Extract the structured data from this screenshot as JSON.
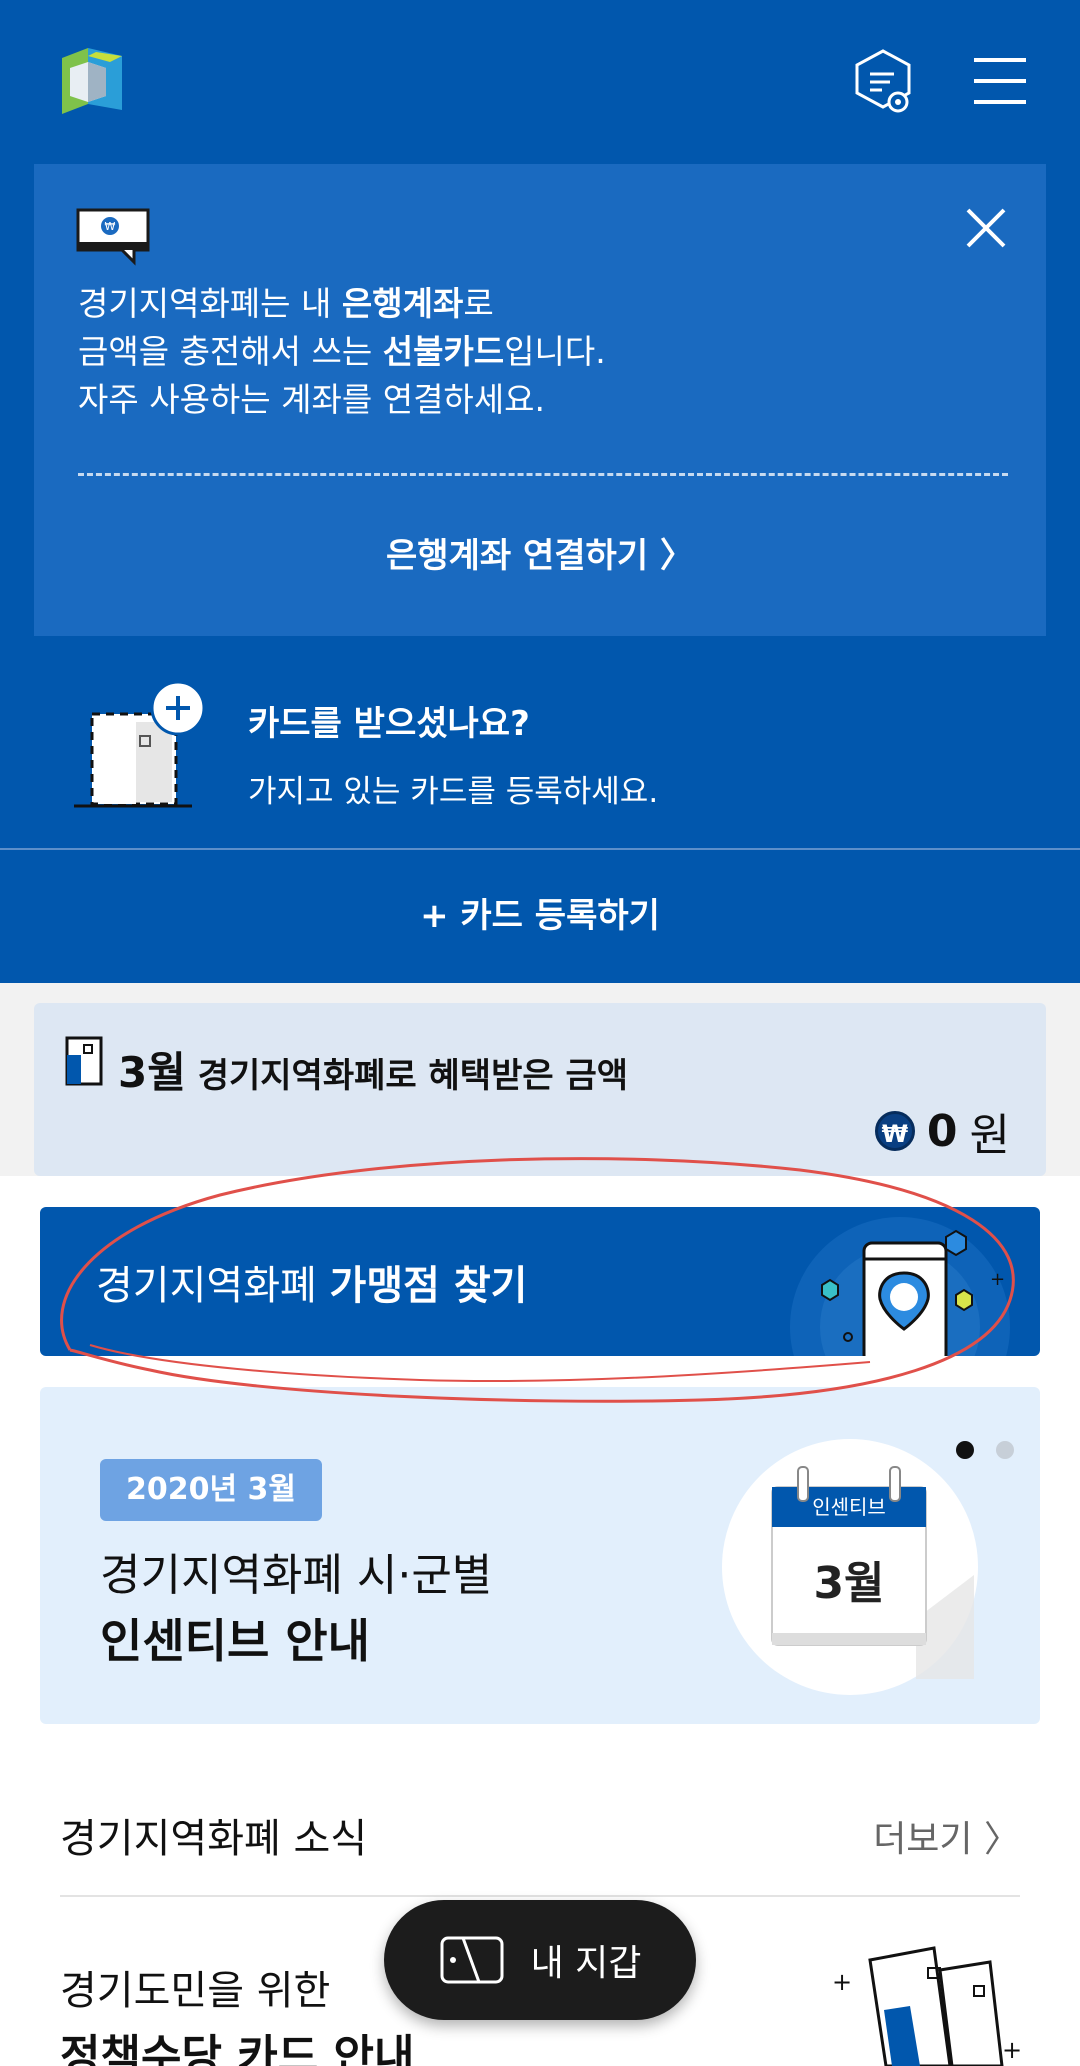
{
  "header": {
    "logo": "gyeonggi-logo",
    "settings_icon": "doc-settings-icon",
    "menu_icon": "hamburger-menu-icon"
  },
  "notice": {
    "line1_a": "경기지역화폐는 내 ",
    "line1_b": "은행계좌",
    "line1_c": "로",
    "line2_a": "금액을 충전해서 쓰는 ",
    "line2_b": "선불카드",
    "line2_c": "입니다.",
    "line3": "자주 사용하는 계좌를 연결하세요.",
    "link_label": "은행계좌 연결하기 〉"
  },
  "card_register": {
    "title": "카드를 받으셨나요?",
    "subtitle": "가지고 있는 카드를 등록하세요.",
    "button_label": "+ 카드 등록하기"
  },
  "benefit": {
    "month": "3월",
    "label": " 경기지역화폐로 혜택받은 금액",
    "amount": "0",
    "unit": "원",
    "coin_symbol": "₩"
  },
  "store_finder": {
    "prefix": "경기지역화폐 ",
    "bold": "가맹점 찾기"
  },
  "incentive": {
    "badge": "2020년 3월",
    "line1": "경기지역화폐 시·군별",
    "line2": "인센티브 안내",
    "calendar_header": "인센티브",
    "calendar_month": "3월"
  },
  "news": {
    "title": "경기지역화폐 소식",
    "more": "더보기 〉"
  },
  "policy": {
    "line1": "경기도민을 위한",
    "line2": "정책수당 카드 안내"
  },
  "wallet": {
    "label": "내 지갑"
  },
  "colors": {
    "primary": "#0157ad",
    "annotation": "#e0504a"
  }
}
